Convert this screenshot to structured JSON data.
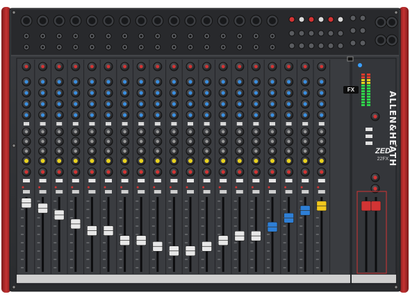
{
  "brand": {
    "name": "ALLEN&HEATH",
    "model": "ZED",
    "variant": "22FX",
    "fx_logo": "FX"
  },
  "colors": {
    "frame_red": "#b92b2b",
    "panel": "#2e3033",
    "cap_white": "#e8e8e8",
    "cap_blue": "#2e7fd6",
    "cap_yellow": "#f2c81e",
    "cap_red": "#d23434",
    "knob_blue": "#3b8fe0",
    "knob_yellow": "#e8d21f",
    "led_blue": "#3aa0ff",
    "meter_green": "#2fd44a",
    "meter_red": "#e23b2b"
  },
  "channels": {
    "mono_count": 16,
    "stereo_count": 3,
    "fader_positions_percent": [
      92,
      85,
      76,
      64,
      55,
      55,
      42,
      42,
      34,
      28,
      28,
      34,
      42,
      48,
      48,
      60,
      72,
      82,
      88
    ],
    "fader_caps": [
      "white",
      "white",
      "white",
      "white",
      "white",
      "white",
      "white",
      "white",
      "white",
      "white",
      "white",
      "white",
      "white",
      "white",
      "white",
      "blue",
      "blue",
      "blue",
      "yellow"
    ]
  },
  "master": {
    "fader_caps": [
      "red",
      "red"
    ],
    "fader_position_percent": 88
  }
}
